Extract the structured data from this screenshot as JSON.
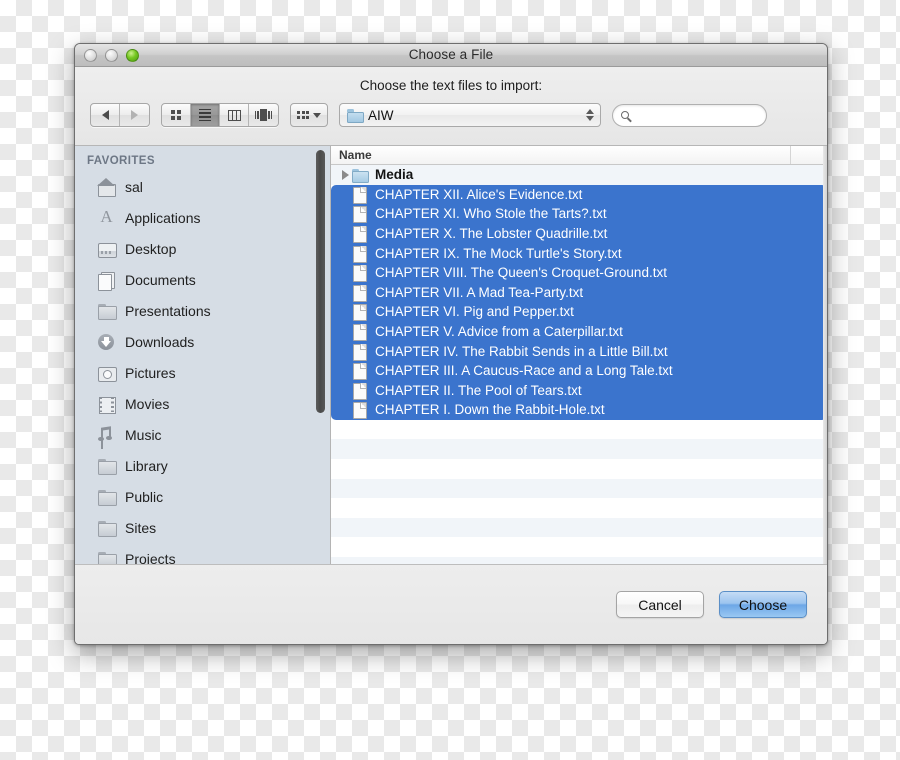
{
  "window": {
    "title": "Choose a File",
    "traffic_lights": [
      "close-disabled",
      "minimize-disabled",
      "zoom-green"
    ]
  },
  "prompt": "Choose the text files to import:",
  "toolbar": {
    "back_icon": "back-arrow-icon",
    "forward_icon": "forward-arrow-icon",
    "views": [
      {
        "name": "icon-view",
        "icon": "grid-icon",
        "selected": false
      },
      {
        "name": "list-view",
        "icon": "list-icon",
        "selected": true
      },
      {
        "name": "column-view",
        "icon": "columns-icon",
        "selected": false
      },
      {
        "name": "coverflow-view",
        "icon": "coverflow-icon",
        "selected": false
      }
    ],
    "action_menu": {
      "icon": "action-grid-icon",
      "caret": "chevron-down-icon"
    },
    "path_popup": {
      "label": "AIW",
      "icon": "folder-icon",
      "stepper": "up-down-stepper-icon"
    },
    "search": {
      "value": "",
      "placeholder": "",
      "icon": "search-icon"
    }
  },
  "sidebar": {
    "header": "FAVORITES",
    "items": [
      {
        "label": "sal",
        "icon": "house-icon"
      },
      {
        "label": "Applications",
        "icon": "applications-icon"
      },
      {
        "label": "Desktop",
        "icon": "desktop-icon"
      },
      {
        "label": "Documents",
        "icon": "documents-icon"
      },
      {
        "label": "Presentations",
        "icon": "folder-icon"
      },
      {
        "label": "Downloads",
        "icon": "downloads-icon"
      },
      {
        "label": "Pictures",
        "icon": "camera-icon"
      },
      {
        "label": "Movies",
        "icon": "film-icon"
      },
      {
        "label": "Music",
        "icon": "music-note-icon"
      },
      {
        "label": "Library",
        "icon": "folder-icon"
      },
      {
        "label": "Public",
        "icon": "folder-icon"
      },
      {
        "label": "Sites",
        "icon": "folder-icon"
      },
      {
        "label": "Projects",
        "icon": "folder-icon"
      }
    ],
    "scrollbar": "vertical-scrollbar"
  },
  "filelist": {
    "columns": [
      "Name"
    ],
    "rows": [
      {
        "label": "Media",
        "icon": "folder-icon",
        "kind": "folder",
        "selected": false,
        "disclosure": "disclosure-triangle-icon"
      },
      {
        "label": "CHAPTER XII. Alice's Evidence.txt",
        "icon": "document-icon",
        "kind": "file",
        "selected": true
      },
      {
        "label": "CHAPTER XI. Who Stole the Tarts?.txt",
        "icon": "document-icon",
        "kind": "file",
        "selected": true
      },
      {
        "label": "CHAPTER X. The Lobster Quadrille.txt",
        "icon": "document-icon",
        "kind": "file",
        "selected": true
      },
      {
        "label": "CHAPTER IX. The Mock Turtle's Story.txt",
        "icon": "document-icon",
        "kind": "file",
        "selected": true
      },
      {
        "label": "CHAPTER VIII. The Queen's Croquet-Ground.txt",
        "icon": "document-icon",
        "kind": "file",
        "selected": true
      },
      {
        "label": "CHAPTER VII. A Mad Tea-Party.txt",
        "icon": "document-icon",
        "kind": "file",
        "selected": true
      },
      {
        "label": "CHAPTER VI. Pig and Pepper.txt",
        "icon": "document-icon",
        "kind": "file",
        "selected": true
      },
      {
        "label": "CHAPTER V. Advice from a Caterpillar.txt",
        "icon": "document-icon",
        "kind": "file",
        "selected": true
      },
      {
        "label": "CHAPTER IV. The Rabbit Sends in a Little Bill.txt",
        "icon": "document-icon",
        "kind": "file",
        "selected": true
      },
      {
        "label": "CHAPTER III. A Caucus-Race and a Long Tale.txt",
        "icon": "document-icon",
        "kind": "file",
        "selected": true
      },
      {
        "label": "CHAPTER II. The Pool of Tears.txt",
        "icon": "document-icon",
        "kind": "file",
        "selected": true
      },
      {
        "label": "CHAPTER I. Down the Rabbit-Hole.txt",
        "icon": "document-icon",
        "kind": "file",
        "selected": true
      }
    ]
  },
  "footer": {
    "cancel_label": "Cancel",
    "choose_label": "Choose"
  },
  "colors": {
    "selection_blue": "#3b74cd",
    "sidebar_bg": "#d6dde5",
    "alt_row": "#f1f5f9",
    "default_button_blue": "#6da7e6",
    "zoom_light_green": "#76c822"
  }
}
